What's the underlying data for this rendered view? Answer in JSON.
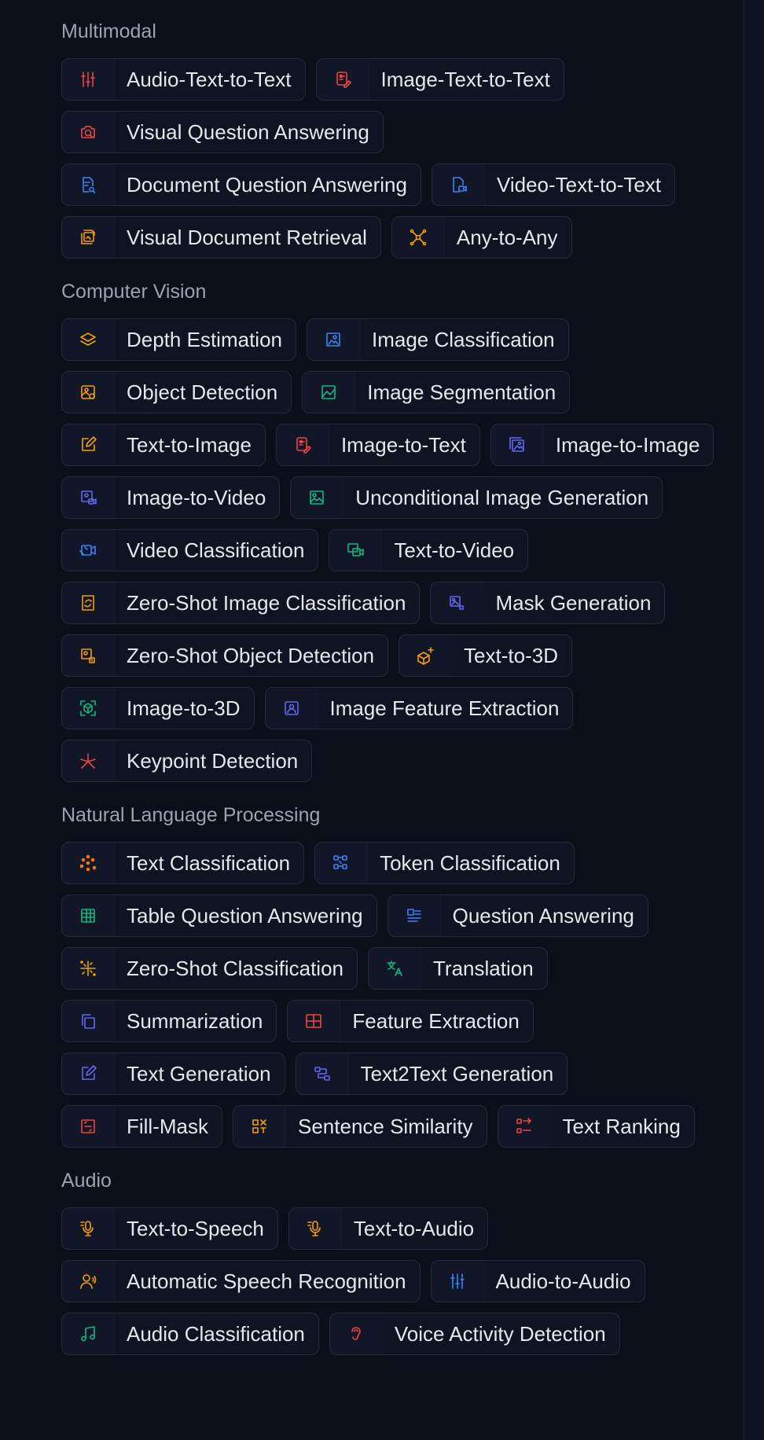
{
  "sections": [
    {
      "title": "Multimodal",
      "items": [
        {
          "label": "Audio-Text-to-Text",
          "icon": "sliders-icon",
          "color": "#ef4444"
        },
        {
          "label": "Image-Text-to-Text",
          "icon": "image-text-icon",
          "color": "#ef4444"
        },
        {
          "label": "Visual Question Answering",
          "icon": "camera-search-icon",
          "color": "#ef4444"
        },
        {
          "label": "Document Question Answering",
          "icon": "document-search-icon",
          "color": "#3b82f6"
        },
        {
          "label": "Video-Text-to-Text",
          "icon": "video-document-icon",
          "color": "#3b82f6"
        },
        {
          "label": "Visual Document Retrieval",
          "icon": "document-retrieval-icon",
          "color": "#f59e0b"
        },
        {
          "label": "Any-to-Any",
          "icon": "network-icon",
          "color": "#f59e0b"
        }
      ]
    },
    {
      "title": "Computer Vision",
      "items": [
        {
          "label": "Depth Estimation",
          "icon": "layers-icon",
          "color": "#f59e0b"
        },
        {
          "label": "Image Classification",
          "icon": "image-classify-icon",
          "color": "#3b82f6"
        },
        {
          "label": "Object Detection",
          "icon": "image-detect-icon",
          "color": "#f59e0b"
        },
        {
          "label": "Image Segmentation",
          "icon": "image-segment-icon",
          "color": "#10b981"
        },
        {
          "label": "Text-to-Image",
          "icon": "pencil-square-icon",
          "color": "#f59e0b"
        },
        {
          "label": "Image-to-Text",
          "icon": "image-text-icon",
          "color": "#ef4444"
        },
        {
          "label": "Image-to-Image",
          "icon": "images-icon",
          "color": "#6366f1"
        },
        {
          "label": "Image-to-Video",
          "icon": "image-video-icon",
          "color": "#6366f1"
        },
        {
          "label": "Unconditional Image Generation",
          "icon": "image-icon",
          "color": "#10b981"
        },
        {
          "label": "Video Classification",
          "icon": "video-classify-icon",
          "color": "#3b82f6"
        },
        {
          "label": "Text-to-Video",
          "icon": "text-video-icon",
          "color": "#10b981"
        },
        {
          "label": "Zero-Shot Image Classification",
          "icon": "frame-refresh-icon",
          "color": "#f59e0b"
        },
        {
          "label": "Mask Generation",
          "icon": "mask-icon",
          "color": "#6366f1"
        },
        {
          "label": "Zero-Shot Object Detection",
          "icon": "zero-shot-detect-icon",
          "color": "#f59e0b"
        },
        {
          "label": "Text-to-3D",
          "icon": "cube-plus-icon",
          "color": "#f59e0b"
        },
        {
          "label": "Image-to-3D",
          "icon": "cube-frame-icon",
          "color": "#10b981"
        },
        {
          "label": "Image Feature Extraction",
          "icon": "image-user-icon",
          "color": "#6366f1"
        },
        {
          "label": "Keypoint Detection",
          "icon": "asterisk-icon",
          "color": "#ef4444"
        }
      ]
    },
    {
      "title": "Natural Language Processing",
      "items": [
        {
          "label": "Text Classification",
          "icon": "dots-icon",
          "color": "#f97316"
        },
        {
          "label": "Token Classification",
          "icon": "tokens-icon",
          "color": "#3b82f6"
        },
        {
          "label": "Table Question Answering",
          "icon": "table-icon",
          "color": "#10b981"
        },
        {
          "label": "Question Answering",
          "icon": "qa-icon",
          "color": "#3b82f6"
        },
        {
          "label": "Zero-Shot Classification",
          "icon": "sparkle-grid-icon",
          "color": "#f59e0b"
        },
        {
          "label": "Translation",
          "icon": "translate-icon",
          "color": "#10b981"
        },
        {
          "label": "Summarization",
          "icon": "copy-icon",
          "color": "#6366f1"
        },
        {
          "label": "Feature Extraction",
          "icon": "grid-table-icon",
          "color": "#ef4444"
        },
        {
          "label": "Text Generation",
          "icon": "pencil-square-icon",
          "color": "#6366f1"
        },
        {
          "label": "Text2Text Generation",
          "icon": "flow-icon",
          "color": "#6366f1"
        },
        {
          "label": "Fill-Mask",
          "icon": "fill-mask-icon",
          "color": "#ef4444"
        },
        {
          "label": "Sentence Similarity",
          "icon": "similarity-icon",
          "color": "#f59e0b"
        },
        {
          "label": "Text Ranking",
          "icon": "ranking-icon",
          "color": "#ef4444"
        }
      ]
    },
    {
      "title": "Audio",
      "items": [
        {
          "label": "Text-to-Speech",
          "icon": "microphone-text-icon",
          "color": "#f59e0b"
        },
        {
          "label": "Text-to-Audio",
          "icon": "microphone-text-icon",
          "color": "#f59e0b"
        },
        {
          "label": "Automatic Speech Recognition",
          "icon": "speaker-person-icon",
          "color": "#f59e0b"
        },
        {
          "label": "Audio-to-Audio",
          "icon": "sliders-icon",
          "color": "#3b82f6"
        },
        {
          "label": "Audio Classification",
          "icon": "music-note-icon",
          "color": "#10b981"
        },
        {
          "label": "Voice Activity Detection",
          "icon": "ear-icon",
          "color": "#ef4444"
        }
      ]
    }
  ]
}
